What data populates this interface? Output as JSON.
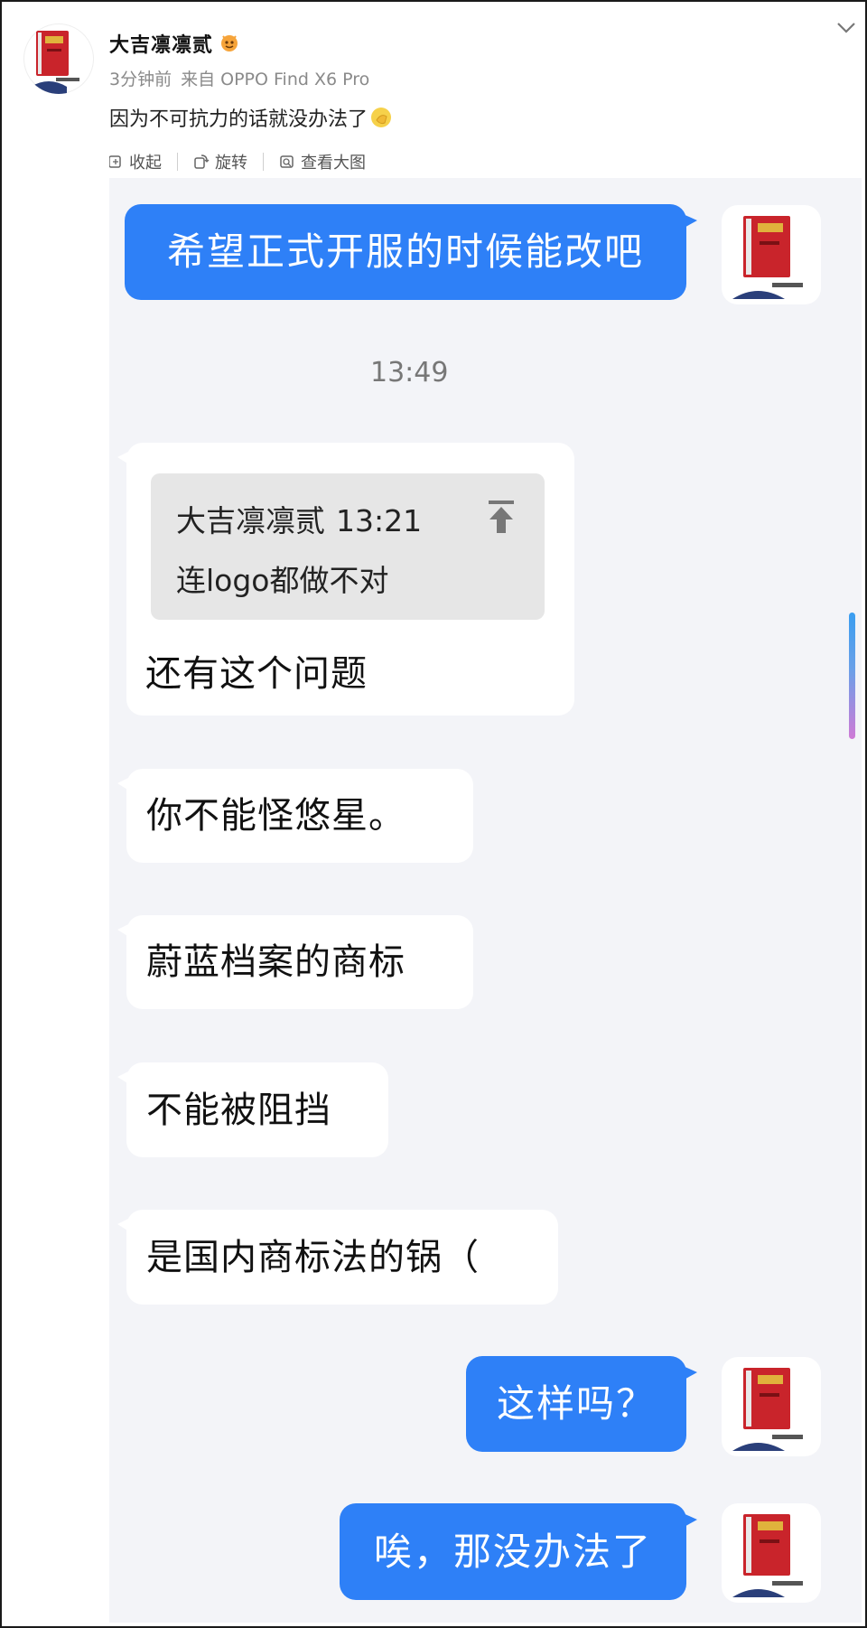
{
  "post": {
    "username": "大吉凛凛贰",
    "time": "3分钟前",
    "source": "来自 OPPO Find X6 Pro",
    "text": "因为不可抗力的话就没办法了",
    "emoji_icon": "emoji-hand-icon"
  },
  "tools": {
    "collapse": "收起",
    "rotate": "旋转",
    "view_large": "查看大图"
  },
  "chat": {
    "msg1": "希望正式开服的时候能改吧",
    "timestamp": "13:49",
    "quote": {
      "sender": "大吉凛凛贰",
      "time": "13:21",
      "text": "连logo都做不对"
    },
    "reply": "还有这个问题",
    "msg3": "你不能怪悠星。",
    "msg4": "蔚蓝档案的商标",
    "msg5": "不能被阻挡",
    "msg6": "是国内商标法的锅（",
    "msg7": "这样吗？",
    "msg8": "唉，那没办法了"
  },
  "colors": {
    "outgoing_bubble": "#2e80f7",
    "chat_background": "#f3f4f8",
    "quote_background": "#e6e6e6"
  }
}
